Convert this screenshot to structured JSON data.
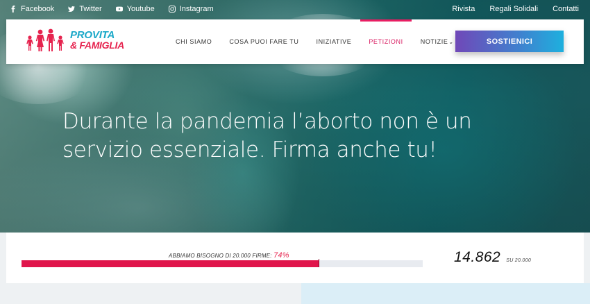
{
  "topbar": {
    "social": [
      {
        "label": "Facebook",
        "icon": "facebook-icon"
      },
      {
        "label": "Twitter",
        "icon": "twitter-icon"
      },
      {
        "label": "Youtube",
        "icon": "youtube-icon"
      },
      {
        "label": "Instagram",
        "icon": "instagram-icon"
      }
    ],
    "links": [
      "Rivista",
      "Regali Solidali",
      "Contatti"
    ]
  },
  "header": {
    "logo_line1": "PROVITA",
    "logo_line2": "& FAMIGLIA",
    "nav": [
      {
        "label": "CHI SIAMO"
      },
      {
        "label": "COSA PUOI FARE TU"
      },
      {
        "label": "INIZIATIVE"
      },
      {
        "label": "PETIZIONI",
        "active": true
      },
      {
        "label": "NOTIZIE",
        "dropdown": true
      }
    ],
    "cta_label": "SOSTIENICI"
  },
  "hero": {
    "headline": "Durante la pandemia l’aborto non è un servizio essenziale. Firma anche tu!"
  },
  "petition": {
    "need_label": "ABBIAMO BISOGNO DI 20.000 FIRME:",
    "percent_label": "74%",
    "progress": 0.74,
    "count": "14.862",
    "goal_label": "SU 20.000"
  },
  "colors": {
    "brand_pink": "#e6244f",
    "brand_blue": "#1aa8c8",
    "cta_start": "#7048b8",
    "cta_end": "#1eb0de"
  }
}
